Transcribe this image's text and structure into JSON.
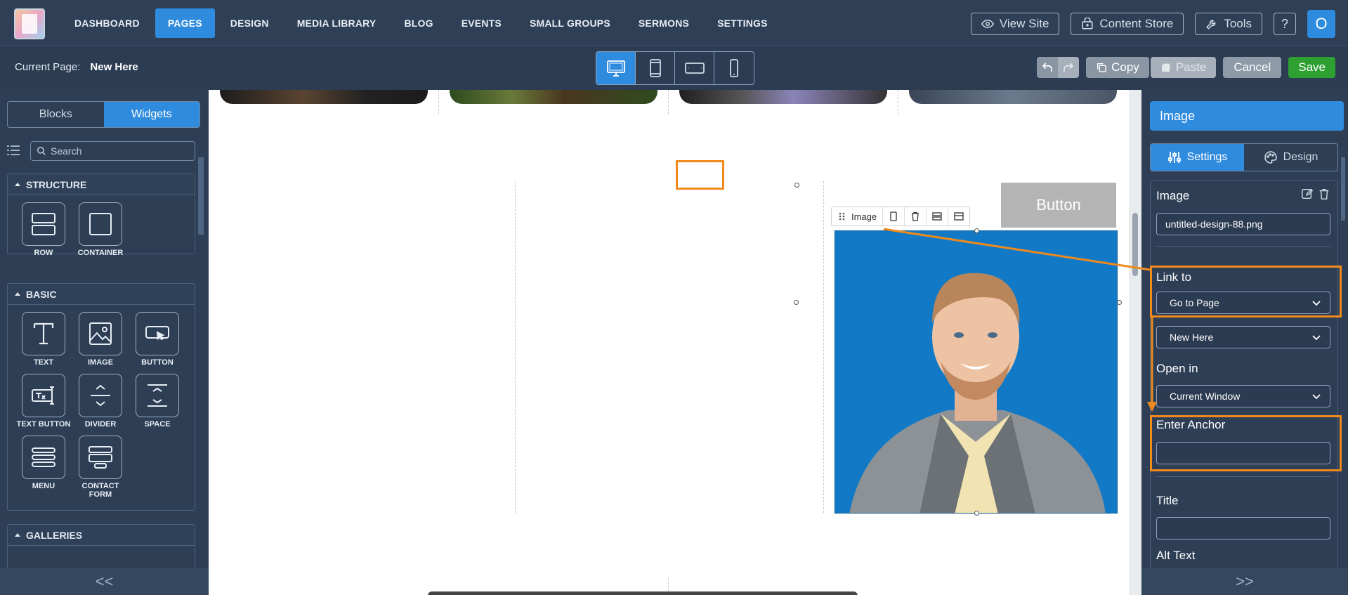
{
  "nav": {
    "items": [
      {
        "label": "DASHBOARD",
        "active": false
      },
      {
        "label": "PAGES",
        "active": true
      },
      {
        "label": "DESIGN",
        "active": false
      },
      {
        "label": "MEDIA LIBRARY",
        "active": false
      },
      {
        "label": "BLOG",
        "active": false
      },
      {
        "label": "EVENTS",
        "active": false
      },
      {
        "label": "SMALL GROUPS",
        "active": false
      },
      {
        "label": "SERMONS",
        "active": false
      },
      {
        "label": "SETTINGS",
        "active": false
      }
    ],
    "view_site": "View Site",
    "content_store": "Content Store",
    "tools": "Tools",
    "help": "?",
    "avatar_initial": "O"
  },
  "subbar": {
    "current_page_label": "Current Page:",
    "current_page_value": "New Here",
    "copy": "Copy",
    "paste": "Paste",
    "cancel": "Cancel",
    "save": "Save"
  },
  "left": {
    "tabs": [
      "Blocks",
      "Widgets"
    ],
    "active_tab": "Widgets",
    "search_placeholder": "Search",
    "structure_title": "STRUCTURE",
    "structure_widgets": [
      "ROW",
      "CONTAINER"
    ],
    "basic_title": "BASIC",
    "basic_widgets": [
      "TEXT",
      "IMAGE",
      "BUTTON",
      "TEXT BUTTON",
      "DIVIDER",
      "SPACE",
      "MENU",
      "CONTACT FORM"
    ],
    "galleries_title": "GALLERIES",
    "collapse": "<<"
  },
  "canvas": {
    "button_label": "Button",
    "toolbar_label": "Image"
  },
  "right": {
    "title": "Image",
    "tab_settings": "Settings",
    "tab_design": "Design",
    "image_label": "Image",
    "image_file": "untitled-design-88.png",
    "link_to_label": "Link to",
    "link_to_value": "Go to Page",
    "page_value": "New Here",
    "open_in_label": "Open in",
    "open_in_value": "Current Window",
    "anchor_label": "Enter Anchor",
    "anchor_value": "",
    "title_label": "Title",
    "title_value": "",
    "alt_label": "Alt Text",
    "expand": ">>"
  },
  "colors": {
    "accent": "#2f8bde",
    "save": "#2ea032",
    "highlight": "#f08a1c",
    "image_bg": "#1279c6"
  }
}
